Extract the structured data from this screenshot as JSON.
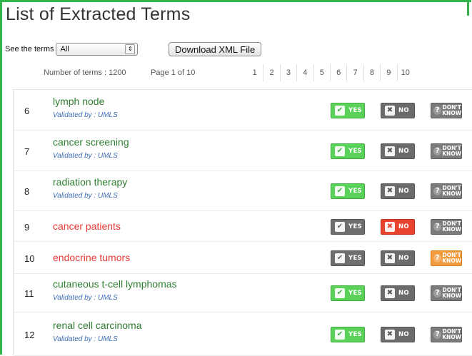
{
  "title": "List of Extracted Terms",
  "controls": {
    "see_terms_label": "See the terms",
    "filter_selected": "All",
    "filter_arrow": "⇕",
    "download_label": "Download XML File"
  },
  "meta": {
    "count_label": "Number of terms : 1200",
    "page_label": "Page 1 of 10"
  },
  "pages": [
    "1",
    "2",
    "3",
    "4",
    "5",
    "6",
    "7",
    "8",
    "9",
    "10"
  ],
  "validated_label": "Validated by : UMLS",
  "buttons": {
    "yes": "YES",
    "no": "NO",
    "dont_know_line1": "DON'T",
    "dont_know_line2": "KNOW"
  },
  "terms": [
    {
      "num": "6",
      "term": "lymph node",
      "validated": true,
      "answer": "yes"
    },
    {
      "num": "7",
      "term": "cancer screening",
      "validated": true,
      "answer": "yes"
    },
    {
      "num": "8",
      "term": "radiation therapy",
      "validated": true,
      "answer": "yes"
    },
    {
      "num": "9",
      "term": "cancer patients",
      "validated": false,
      "answer": "no"
    },
    {
      "num": "10",
      "term": "endocrine tumors",
      "validated": false,
      "answer": "dont_know"
    },
    {
      "num": "11",
      "term": "cutaneous t-cell lymphomas",
      "validated": true,
      "answer": "yes"
    },
    {
      "num": "12",
      "term": "renal cell carcinoma",
      "validated": true,
      "answer": "yes"
    }
  ],
  "colors": {
    "frame": "#2fb34a",
    "valid_term": "#2e7d32",
    "invalid_term": "#e53935",
    "yes_active": "#5ad25a",
    "no_active": "#e8432f",
    "dont_know_active": "#f29a3c",
    "validated_text": "#3f6fb6"
  }
}
